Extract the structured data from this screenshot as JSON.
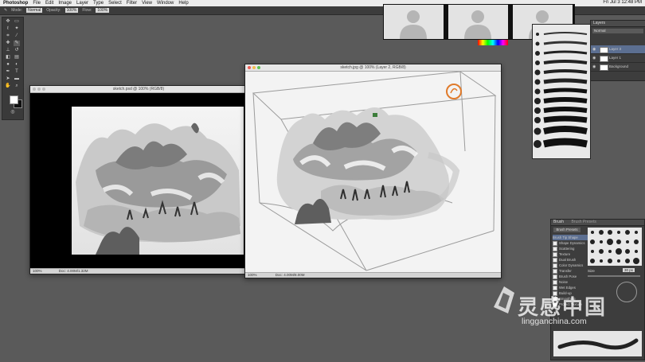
{
  "menubar": {
    "apple": "",
    "app": "Photoshop",
    "items": [
      "File",
      "Edit",
      "Image",
      "Layer",
      "Type",
      "Select",
      "Filter",
      "View",
      "Window",
      "Help"
    ],
    "clock": "Fri Jul 3  12:48 PM"
  },
  "options_bar": {
    "mode_label": "Mode:",
    "mode_value": "Normal",
    "opacity_label": "Opacity:",
    "opacity_value": "100%",
    "flow_label": "Flow:",
    "flow_value": "100%"
  },
  "doc_left": {
    "title": "sketch.psd @ 100% (RGB/8)",
    "zoom": "100%",
    "doc_info": "Doc: 4.00M/1.32M"
  },
  "doc_right": {
    "title": "sketch.jpg @ 100% (Layer 2, RGB/8)",
    "zoom": "100%",
    "doc_info": "Doc: 4.00M/8.00M"
  },
  "layers_panel": {
    "tab": "Layers",
    "kind": "Normal",
    "layers": [
      {
        "name": "Layer 3"
      },
      {
        "name": "Layer 1"
      },
      {
        "name": "Background"
      }
    ]
  },
  "brush_panel": {
    "tabs": [
      "Brush",
      "Brush Presets"
    ],
    "button": "Brush Presets",
    "options": [
      "Brush Tip Shape",
      "Shape Dynamics",
      "Scattering",
      "Texture",
      "Dual Brush",
      "Color Dynamics",
      "Transfer",
      "Brush Pose",
      "Noise",
      "Wet Edges",
      "Build-up",
      "Smoothing",
      "Protect Texture"
    ],
    "size_label": "Size",
    "size_value": "30 px"
  },
  "watermark": {
    "cn_text": "灵感中国",
    "url": "lingganchina.com"
  },
  "colors": {
    "orange_mark": "#e07a2a",
    "green_mark": "#3c7d3a"
  }
}
